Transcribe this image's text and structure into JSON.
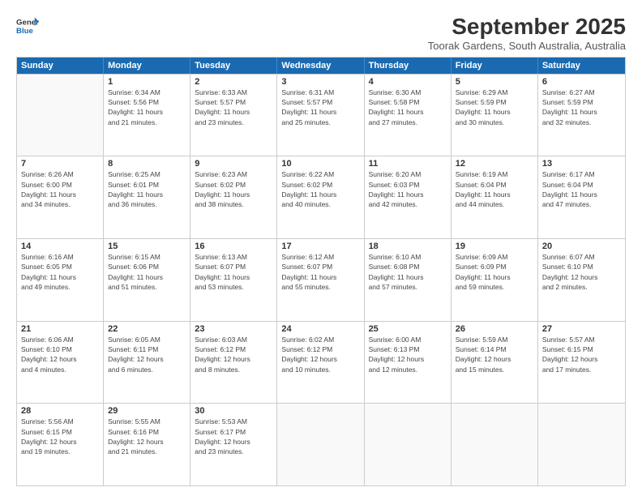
{
  "logo": {
    "general": "General",
    "blue": "Blue"
  },
  "header": {
    "month": "September 2025",
    "location": "Toorak Gardens, South Australia, Australia"
  },
  "weekdays": [
    "Sunday",
    "Monday",
    "Tuesday",
    "Wednesday",
    "Thursday",
    "Friday",
    "Saturday"
  ],
  "weeks": [
    [
      {
        "day": "",
        "info": ""
      },
      {
        "day": "1",
        "info": "Sunrise: 6:34 AM\nSunset: 5:56 PM\nDaylight: 11 hours\nand 21 minutes."
      },
      {
        "day": "2",
        "info": "Sunrise: 6:33 AM\nSunset: 5:57 PM\nDaylight: 11 hours\nand 23 minutes."
      },
      {
        "day": "3",
        "info": "Sunrise: 6:31 AM\nSunset: 5:57 PM\nDaylight: 11 hours\nand 25 minutes."
      },
      {
        "day": "4",
        "info": "Sunrise: 6:30 AM\nSunset: 5:58 PM\nDaylight: 11 hours\nand 27 minutes."
      },
      {
        "day": "5",
        "info": "Sunrise: 6:29 AM\nSunset: 5:59 PM\nDaylight: 11 hours\nand 30 minutes."
      },
      {
        "day": "6",
        "info": "Sunrise: 6:27 AM\nSunset: 5:59 PM\nDaylight: 11 hours\nand 32 minutes."
      }
    ],
    [
      {
        "day": "7",
        "info": "Sunrise: 6:26 AM\nSunset: 6:00 PM\nDaylight: 11 hours\nand 34 minutes."
      },
      {
        "day": "8",
        "info": "Sunrise: 6:25 AM\nSunset: 6:01 PM\nDaylight: 11 hours\nand 36 minutes."
      },
      {
        "day": "9",
        "info": "Sunrise: 6:23 AM\nSunset: 6:02 PM\nDaylight: 11 hours\nand 38 minutes."
      },
      {
        "day": "10",
        "info": "Sunrise: 6:22 AM\nSunset: 6:02 PM\nDaylight: 11 hours\nand 40 minutes."
      },
      {
        "day": "11",
        "info": "Sunrise: 6:20 AM\nSunset: 6:03 PM\nDaylight: 11 hours\nand 42 minutes."
      },
      {
        "day": "12",
        "info": "Sunrise: 6:19 AM\nSunset: 6:04 PM\nDaylight: 11 hours\nand 44 minutes."
      },
      {
        "day": "13",
        "info": "Sunrise: 6:17 AM\nSunset: 6:04 PM\nDaylight: 11 hours\nand 47 minutes."
      }
    ],
    [
      {
        "day": "14",
        "info": "Sunrise: 6:16 AM\nSunset: 6:05 PM\nDaylight: 11 hours\nand 49 minutes."
      },
      {
        "day": "15",
        "info": "Sunrise: 6:15 AM\nSunset: 6:06 PM\nDaylight: 11 hours\nand 51 minutes."
      },
      {
        "day": "16",
        "info": "Sunrise: 6:13 AM\nSunset: 6:07 PM\nDaylight: 11 hours\nand 53 minutes."
      },
      {
        "day": "17",
        "info": "Sunrise: 6:12 AM\nSunset: 6:07 PM\nDaylight: 11 hours\nand 55 minutes."
      },
      {
        "day": "18",
        "info": "Sunrise: 6:10 AM\nSunset: 6:08 PM\nDaylight: 11 hours\nand 57 minutes."
      },
      {
        "day": "19",
        "info": "Sunrise: 6:09 AM\nSunset: 6:09 PM\nDaylight: 11 hours\nand 59 minutes."
      },
      {
        "day": "20",
        "info": "Sunrise: 6:07 AM\nSunset: 6:10 PM\nDaylight: 12 hours\nand 2 minutes."
      }
    ],
    [
      {
        "day": "21",
        "info": "Sunrise: 6:06 AM\nSunset: 6:10 PM\nDaylight: 12 hours\nand 4 minutes."
      },
      {
        "day": "22",
        "info": "Sunrise: 6:05 AM\nSunset: 6:11 PM\nDaylight: 12 hours\nand 6 minutes."
      },
      {
        "day": "23",
        "info": "Sunrise: 6:03 AM\nSunset: 6:12 PM\nDaylight: 12 hours\nand 8 minutes."
      },
      {
        "day": "24",
        "info": "Sunrise: 6:02 AM\nSunset: 6:12 PM\nDaylight: 12 hours\nand 10 minutes."
      },
      {
        "day": "25",
        "info": "Sunrise: 6:00 AM\nSunset: 6:13 PM\nDaylight: 12 hours\nand 12 minutes."
      },
      {
        "day": "26",
        "info": "Sunrise: 5:59 AM\nSunset: 6:14 PM\nDaylight: 12 hours\nand 15 minutes."
      },
      {
        "day": "27",
        "info": "Sunrise: 5:57 AM\nSunset: 6:15 PM\nDaylight: 12 hours\nand 17 minutes."
      }
    ],
    [
      {
        "day": "28",
        "info": "Sunrise: 5:56 AM\nSunset: 6:15 PM\nDaylight: 12 hours\nand 19 minutes."
      },
      {
        "day": "29",
        "info": "Sunrise: 5:55 AM\nSunset: 6:16 PM\nDaylight: 12 hours\nand 21 minutes."
      },
      {
        "day": "30",
        "info": "Sunrise: 5:53 AM\nSunset: 6:17 PM\nDaylight: 12 hours\nand 23 minutes."
      },
      {
        "day": "",
        "info": ""
      },
      {
        "day": "",
        "info": ""
      },
      {
        "day": "",
        "info": ""
      },
      {
        "day": "",
        "info": ""
      }
    ]
  ]
}
